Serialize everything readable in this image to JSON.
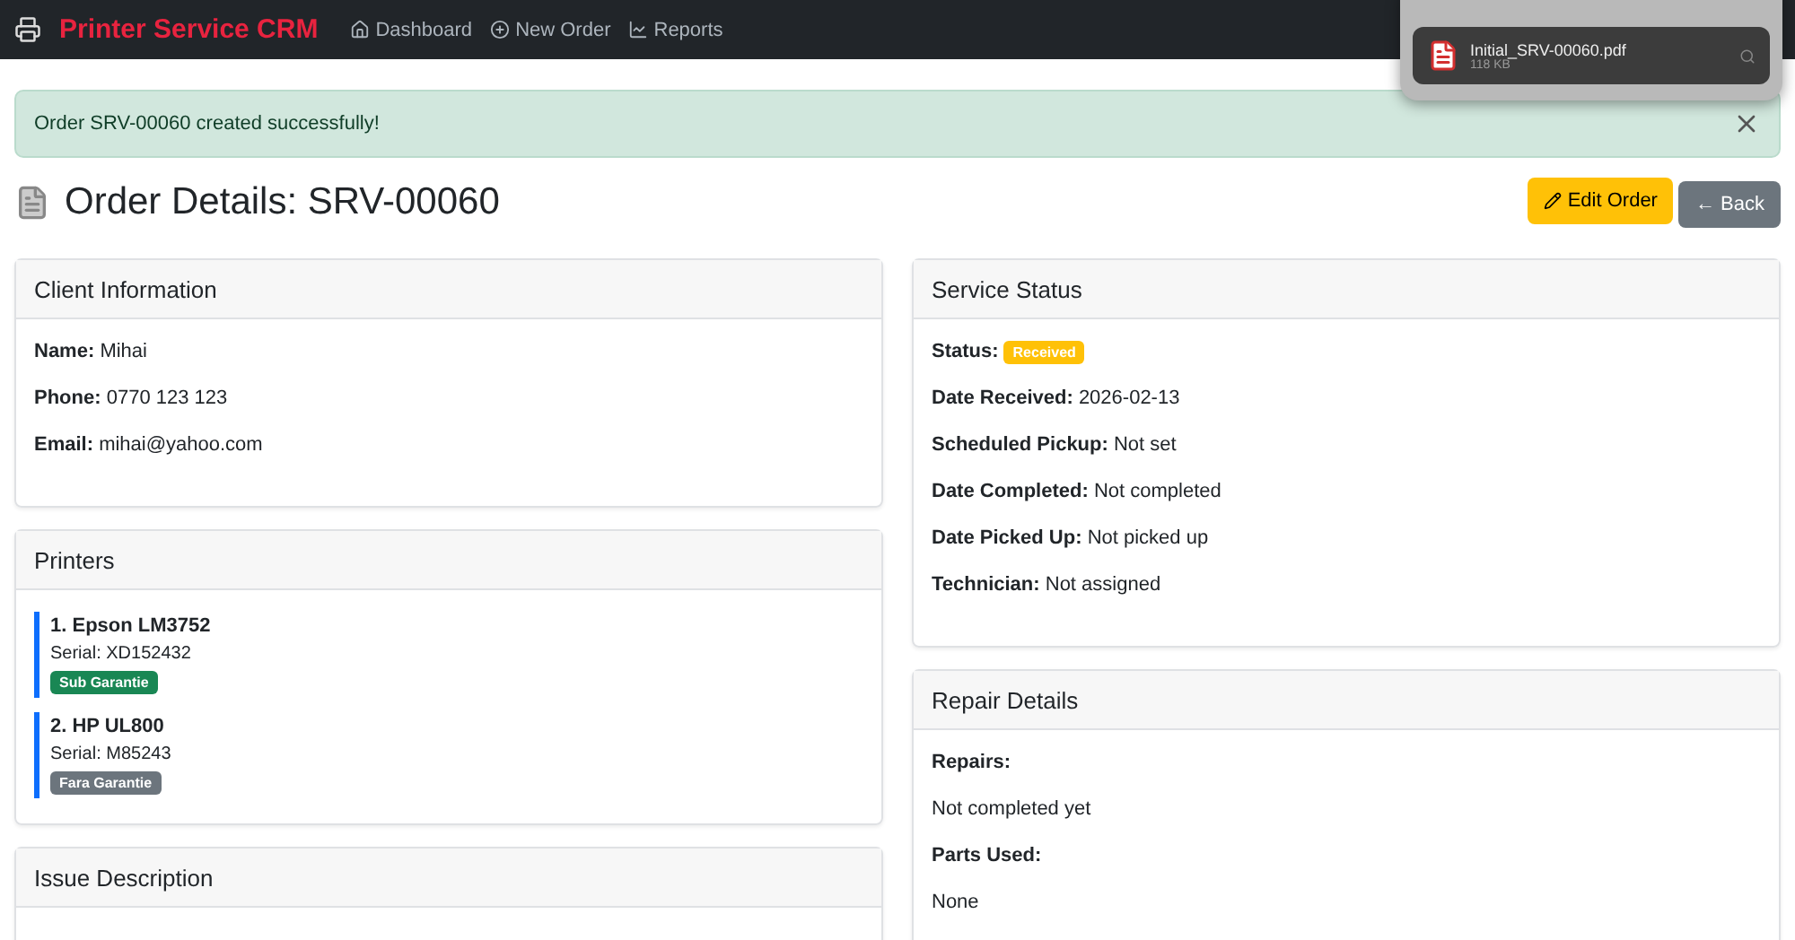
{
  "navbar": {
    "brand": "Printer Service CRM",
    "links": [
      {
        "label": "Dashboard",
        "kind": "home"
      },
      {
        "label": "New Order",
        "kind": "plus"
      },
      {
        "label": "Reports",
        "kind": "chart"
      }
    ]
  },
  "downloads": {
    "files": [
      {
        "name": "Initial_SRV-00060.pdf",
        "size": "118 KB"
      }
    ]
  },
  "alert": {
    "message": "Order SRV-00060 created successfully!"
  },
  "page": {
    "title": "Order Details: SRV-00060",
    "buttons": [
      {
        "label": "Edit Order",
        "kind": "edit"
      },
      {
        "label": "← Back",
        "kind": "back"
      }
    ]
  },
  "client": {
    "title": "Client Information",
    "fields": [
      {
        "label": "Name:",
        "value": "Mihai"
      },
      {
        "label": "Phone:",
        "value": "0770 123 123"
      },
      {
        "label": "Email:",
        "value": "mihai@yahoo.com"
      }
    ]
  },
  "printers": {
    "title": "Printers",
    "items": [
      {
        "name": "1. Epson LM3752",
        "serial": "Serial: XD152432",
        "badge": "Sub Garantie",
        "color": "#198754"
      },
      {
        "name": "2. HP UL800",
        "serial": "Serial: M85243",
        "badge": "Fara Garantie",
        "color": "#6c757d"
      }
    ]
  },
  "issue": {
    "title": "Issue Description"
  },
  "service": {
    "title": "Service Status",
    "status_label": "Status:",
    "status": "Received",
    "fields": [
      {
        "label": "Date Received:",
        "value": "2026-02-13"
      },
      {
        "label": "Scheduled Pickup:",
        "value": "Not set"
      },
      {
        "label": "Date Completed:",
        "value": "Not completed"
      },
      {
        "label": "Date Picked Up:",
        "value": "Not picked up"
      },
      {
        "label": "Technician:",
        "value": "Not assigned"
      }
    ]
  },
  "repair": {
    "title": "Repair Details",
    "lines": [
      {
        "kind": "label",
        "text": "Repairs:"
      },
      {
        "kind": "text",
        "text": "Not completed yet"
      },
      {
        "kind": "label",
        "text": "Parts Used:"
      },
      {
        "kind": "text",
        "text": "None"
      }
    ]
  }
}
